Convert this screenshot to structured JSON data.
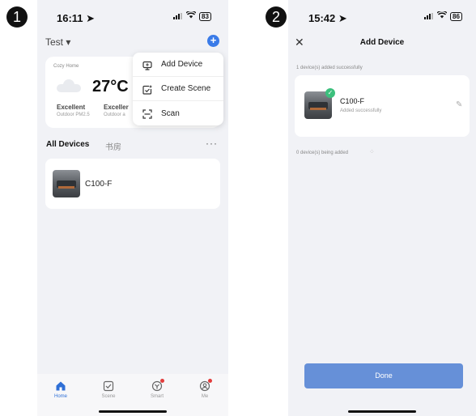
{
  "steps": {
    "one": "1",
    "two": "2"
  },
  "phone1": {
    "status": {
      "time": "16:11",
      "battery": "83"
    },
    "home_name": "Test ▾",
    "weather": {
      "location": "Cozy Home",
      "temperature": "27°C",
      "quality1": "Excellent",
      "quality1_sub": "Outdoor PM2.5",
      "quality2": "Exceller",
      "quality2_sub": "Outdoor a"
    },
    "menu": [
      {
        "label": "Add Device",
        "icon": "add-device-icon"
      },
      {
        "label": "Create Scene",
        "icon": "create-scene-icon"
      },
      {
        "label": "Scan",
        "icon": "scan-icon"
      }
    ],
    "tabs": {
      "all": "All Devices",
      "room": "书房"
    },
    "device": {
      "name": "C100-F"
    },
    "nav": [
      {
        "label": "Home",
        "icon": "home-icon"
      },
      {
        "label": "Scene",
        "icon": "scene-icon"
      },
      {
        "label": "Smart",
        "icon": "smart-icon"
      },
      {
        "label": "Me",
        "icon": "me-icon"
      }
    ]
  },
  "phone2": {
    "status": {
      "time": "15:42",
      "battery": "86"
    },
    "title": "Add Device",
    "added_text": "1 device(s) added successfully",
    "device": {
      "name": "C100-F",
      "status": "Added successfully"
    },
    "adding_text": "0 device(s) being added",
    "done_label": "Done"
  },
  "colors": {
    "accent": "#3a7be8",
    "done": "#6690d8",
    "success": "#3cc07d",
    "badge": "#e23c3c"
  }
}
